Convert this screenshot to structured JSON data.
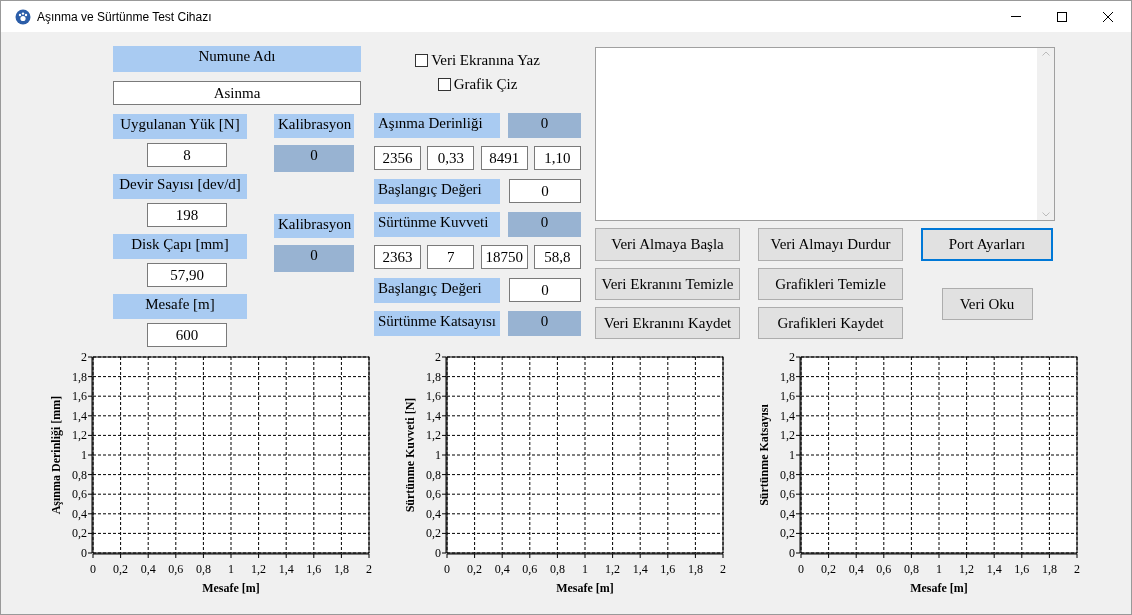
{
  "window": {
    "title": "Aşınma ve Sürtünme Test Cihazı"
  },
  "sample": {
    "label": "Numune Adı",
    "value": "Asinma"
  },
  "parameters": [
    {
      "label": "Uygulanan Yük [N]",
      "value": "8"
    },
    {
      "label": "Devir Sayısı [dev/d]",
      "value": "198"
    },
    {
      "label": "Disk Çapı [mm]",
      "value": "57,90"
    },
    {
      "label": "Mesafe [m]",
      "value": "600"
    }
  ],
  "calibrations": [
    {
      "label": "Kalibrasyon",
      "value": "0"
    },
    {
      "label": "Kalibrasyon",
      "value": "0"
    }
  ],
  "checkboxes": [
    {
      "label": "Veri Ekranına Yaz",
      "checked": false
    },
    {
      "label": "Grafik Çiz",
      "checked": false
    }
  ],
  "measurements": [
    {
      "label": "Aşınma Derinliği",
      "value": "0",
      "fields": [
        "2356",
        "0,33",
        "8491",
        "1,10"
      ],
      "baseline": {
        "label": "Başlangıç Değeri",
        "value": "0"
      }
    },
    {
      "label": "Sürtünme Kuvveti",
      "value": "0",
      "fields": [
        "2363",
        "7",
        "18750",
        "58,8"
      ],
      "baseline": {
        "label": "Başlangıç Değeri",
        "value": "0"
      }
    }
  ],
  "coefficient": {
    "label": "Sürtünme Katsayısı",
    "value": "0"
  },
  "button_columns": [
    [
      {
        "label": "Veri Almaya Başla",
        "focused": false
      },
      {
        "label": "Veri Ekranını Temizle",
        "focused": false
      },
      {
        "label": "Veri Ekranını Kaydet",
        "focused": false
      }
    ],
    [
      {
        "label": "Veri Almayı Durdur",
        "focused": false
      },
      {
        "label": "Grafikleri Temizle",
        "focused": false
      },
      {
        "label": "Grafikleri Kaydet",
        "focused": false
      }
    ],
    [
      {
        "label": "Port Ayarları",
        "focused": true
      },
      {
        "label": "Veri Oku",
        "focused": false
      }
    ]
  ],
  "charts": [
    {
      "chart_data": {
        "type": "line",
        "grid": true,
        "xlabel": "Mesafe [m]",
        "ylabel": "Aşınma Derinliği [mm]",
        "xlim": [
          0,
          2
        ],
        "ylim": [
          0,
          2
        ],
        "xticks": [
          0,
          {
            "value": 0.2,
            "label": "0,2"
          },
          {
            "value": 0.4,
            "label": "0,4"
          },
          {
            "value": 0.6,
            "label": "0,6"
          },
          {
            "value": 0.8,
            "label": "0,8"
          },
          1,
          {
            "value": 1.2,
            "label": "1,2"
          },
          {
            "value": 1.4,
            "label": "1,4"
          },
          {
            "value": 1.6,
            "label": "1,6"
          },
          {
            "value": 1.8,
            "label": "1,8"
          },
          2
        ],
        "yticks": [
          0,
          {
            "value": 0.2,
            "label": "0,2"
          },
          {
            "value": 0.4,
            "label": "0,4"
          },
          {
            "value": 0.6,
            "label": "0,6"
          },
          {
            "value": 0.8,
            "label": "0,8"
          },
          1,
          {
            "value": 1.2,
            "label": "1,2"
          },
          {
            "value": 1.4,
            "label": "1,4"
          },
          {
            "value": 1.6,
            "label": "1,6"
          },
          {
            "value": 1.8,
            "label": "1,8"
          },
          2
        ]
      }
    },
    {
      "chart_data": {
        "type": "line",
        "grid": true,
        "xlabel": "Mesafe [m]",
        "ylabel": "Sürtünme Kuvveti [N]",
        "xlim": [
          0,
          2
        ],
        "ylim": [
          0,
          2
        ],
        "xticks": [
          0,
          {
            "value": 0.2,
            "label": "0,2"
          },
          {
            "value": 0.4,
            "label": "0,4"
          },
          {
            "value": 0.6,
            "label": "0,6"
          },
          {
            "value": 0.8,
            "label": "0,8"
          },
          1,
          {
            "value": 1.2,
            "label": "1,2"
          },
          {
            "value": 1.4,
            "label": "1,4"
          },
          {
            "value": 1.6,
            "label": "1,6"
          },
          {
            "value": 1.8,
            "label": "1,8"
          },
          2
        ],
        "yticks": [
          0,
          {
            "value": 0.2,
            "label": "0,2"
          },
          {
            "value": 0.4,
            "label": "0,4"
          },
          {
            "value": 0.6,
            "label": "0,6"
          },
          {
            "value": 0.8,
            "label": "0,8"
          },
          1,
          {
            "value": 1.2,
            "label": "1,2"
          },
          {
            "value": 1.4,
            "label": "1,4"
          },
          {
            "value": 1.6,
            "label": "1,6"
          },
          {
            "value": 1.8,
            "label": "1,8"
          },
          2
        ]
      }
    },
    {
      "chart_data": {
        "type": "line",
        "grid": true,
        "xlabel": "Mesafe [m]",
        "ylabel": "Sürtünme Katsayısı",
        "xlim": [
          0,
          2
        ],
        "ylim": [
          0,
          2
        ],
        "xticks": [
          0,
          {
            "value": 0.2,
            "label": "0,2"
          },
          {
            "value": 0.4,
            "label": "0,4"
          },
          {
            "value": 0.6,
            "label": "0,6"
          },
          {
            "value": 0.8,
            "label": "0,8"
          },
          1,
          {
            "value": 1.2,
            "label": "1,2"
          },
          {
            "value": 1.4,
            "label": "1,4"
          },
          {
            "value": 1.6,
            "label": "1,6"
          },
          {
            "value": 1.8,
            "label": "1,8"
          },
          2
        ],
        "yticks": [
          0,
          {
            "value": 0.2,
            "label": "0,2"
          },
          {
            "value": 0.4,
            "label": "0,4"
          },
          {
            "value": 0.6,
            "label": "0,6"
          },
          {
            "value": 0.8,
            "label": "0,8"
          },
          1,
          {
            "value": 1.2,
            "label": "1,2"
          },
          {
            "value": 1.4,
            "label": "1,4"
          },
          {
            "value": 1.6,
            "label": "1,6"
          },
          {
            "value": 1.8,
            "label": "1,8"
          },
          2
        ]
      }
    }
  ]
}
